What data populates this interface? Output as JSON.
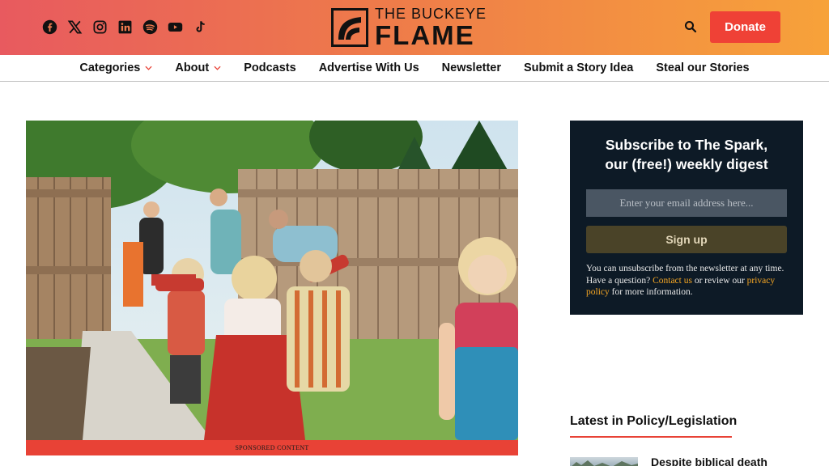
{
  "header": {
    "brand_top": "THE BUCKEYE",
    "brand_bottom": "FLAME",
    "donate_label": "Donate",
    "social_icons": [
      "facebook-icon",
      "x-icon",
      "instagram-icon",
      "linkedin-icon",
      "spotify-icon",
      "youtube-icon",
      "tiktok-icon"
    ]
  },
  "nav": {
    "items": [
      {
        "label": "Categories",
        "dropdown": true
      },
      {
        "label": "About",
        "dropdown": true
      },
      {
        "label": "Podcasts",
        "dropdown": false
      },
      {
        "label": "Advertise With Us",
        "dropdown": false
      },
      {
        "label": "Newsletter",
        "dropdown": false
      },
      {
        "label": "Submit a Story Idea",
        "dropdown": false
      },
      {
        "label": "Steal our Stories",
        "dropdown": false
      }
    ]
  },
  "hero": {
    "caption_bar": "SPONSORED CONTENT"
  },
  "subscribe": {
    "title_line1": "Subscribe to The Spark,",
    "title_line2": "our (free!) weekly digest",
    "email_placeholder": "Enter your email address here...",
    "button_label": "Sign up",
    "note_part1": "You can unsubscribe from the newsletter at any time. Have a question? ",
    "contact_link": "Contact us",
    "note_part2": " or review our ",
    "privacy_link": "privacy policy",
    "note_part3": " for more information."
  },
  "latest": {
    "title": "Latest in Policy/Legislation",
    "first_headline": "Despite biblical death"
  },
  "colors": {
    "accent": "#ef4136",
    "gradient_start": "#e85a5f",
    "gradient_end": "#f7a23a",
    "subscribe_bg": "#0d1a26",
    "link": "#f5a623"
  }
}
